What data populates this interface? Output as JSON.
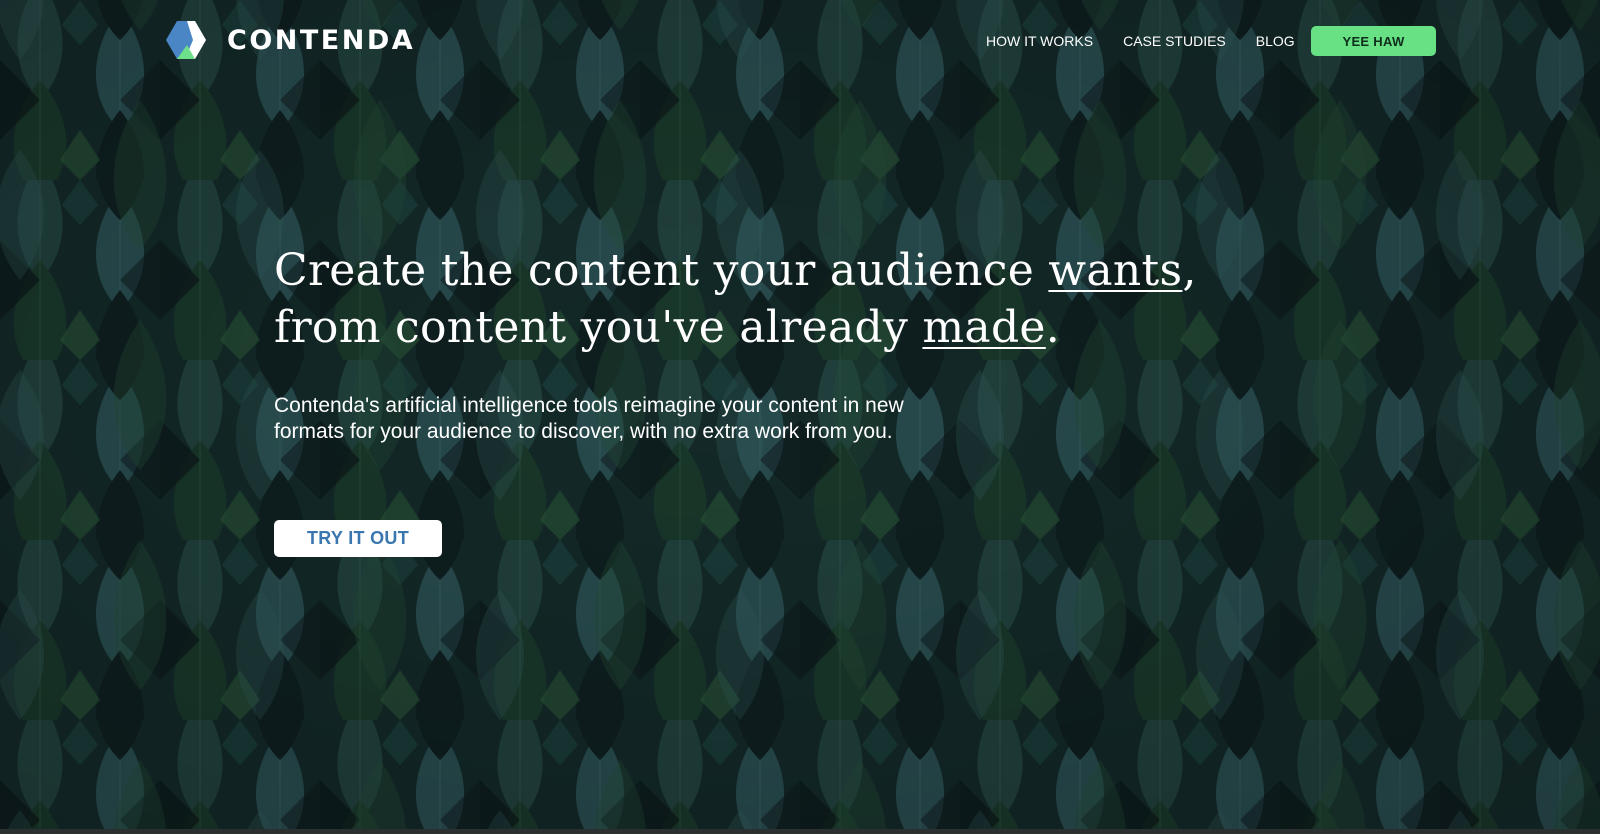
{
  "brand": {
    "name": "CONTENDA",
    "logo_icon": "contenda-hexagon-logo-icon",
    "colors": {
      "blue": "#4a86c5",
      "green": "#6fe08a",
      "white": "#ffffff"
    }
  },
  "nav": {
    "items": [
      {
        "label": "HOW IT WORKS"
      },
      {
        "label": "CASE STUDIES"
      },
      {
        "label": "BLOG"
      }
    ],
    "cta_label": "YEE HAW",
    "cta_color": "#68e084"
  },
  "hero": {
    "headline_line1_prefix": "Create the content your audience ",
    "headline_line1_emph": "wants",
    "headline_line1_suffix": ",",
    "headline_line2_prefix": "from content you've already ",
    "headline_line2_emph": "made",
    "headline_line2_suffix": ".",
    "subtext": "Contenda's artificial intelligence tools reimagine your content in new formats for your audience to discover, with no extra work from you.",
    "cta_label": "TRY IT OUT"
  },
  "background": {
    "description_icon": "dark-green-leaf-pattern",
    "colors": [
      "#102523",
      "#1c3b3a",
      "#274d4b",
      "#204a33",
      "#0b1719"
    ]
  }
}
